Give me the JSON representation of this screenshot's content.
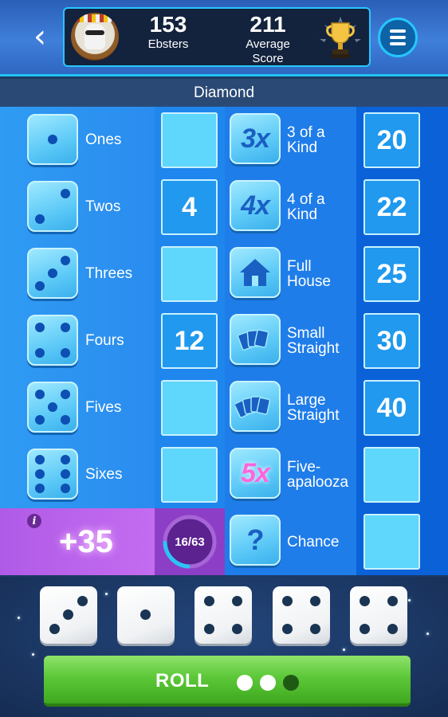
{
  "header": {
    "back_icon": "chevron-left-icon",
    "ebsters_value": "153",
    "ebsters_label": "Ebsters",
    "avg_value": "211",
    "avg_label_line1": "Average",
    "avg_label_line2": "Score",
    "trophy_icon": "trophy-icon",
    "menu_icon": "hamburger-menu-icon"
  },
  "level": "Diamond",
  "upper": [
    {
      "label": "Ones",
      "score": ""
    },
    {
      "label": "Twos",
      "score": "4"
    },
    {
      "label": "Threes",
      "score": ""
    },
    {
      "label": "Fours",
      "score": "12"
    },
    {
      "label": "Fives",
      "score": ""
    },
    {
      "label": "Sixes",
      "score": ""
    }
  ],
  "lower": [
    {
      "icon_text": "3x",
      "line1": "3 of a",
      "line2": "Kind",
      "score": "20"
    },
    {
      "icon_text": "4x",
      "line1": "4 of a",
      "line2": "Kind",
      "score": "22"
    },
    {
      "icon": "house-icon",
      "line1": "Full",
      "line2": "House",
      "score": "25"
    },
    {
      "icon": "small-straight-cards-icon",
      "line1": "Small",
      "line2": "Straight",
      "score": "30"
    },
    {
      "icon": "large-straight-cards-icon",
      "line1": "Large",
      "line2": "Straight",
      "score": "40"
    },
    {
      "icon_text": "5x",
      "line1": "Five-",
      "line2": "apalooza",
      "score": ""
    },
    {
      "icon": "question-mark-icon",
      "line1": "Chance",
      "line2": "",
      "score": ""
    }
  ],
  "bonus": {
    "value": "+35",
    "progress_text": "16/63",
    "progress_fraction": 0.254
  },
  "dice": [
    3,
    1,
    4,
    4,
    4
  ],
  "roll": {
    "label": "ROLL",
    "rolls_remaining": 2,
    "rolls_total": 3
  },
  "colors": {
    "accent_cyan": "#27c7ff",
    "roll_green": "#5cc838",
    "bonus_purple": "#b05be8"
  }
}
